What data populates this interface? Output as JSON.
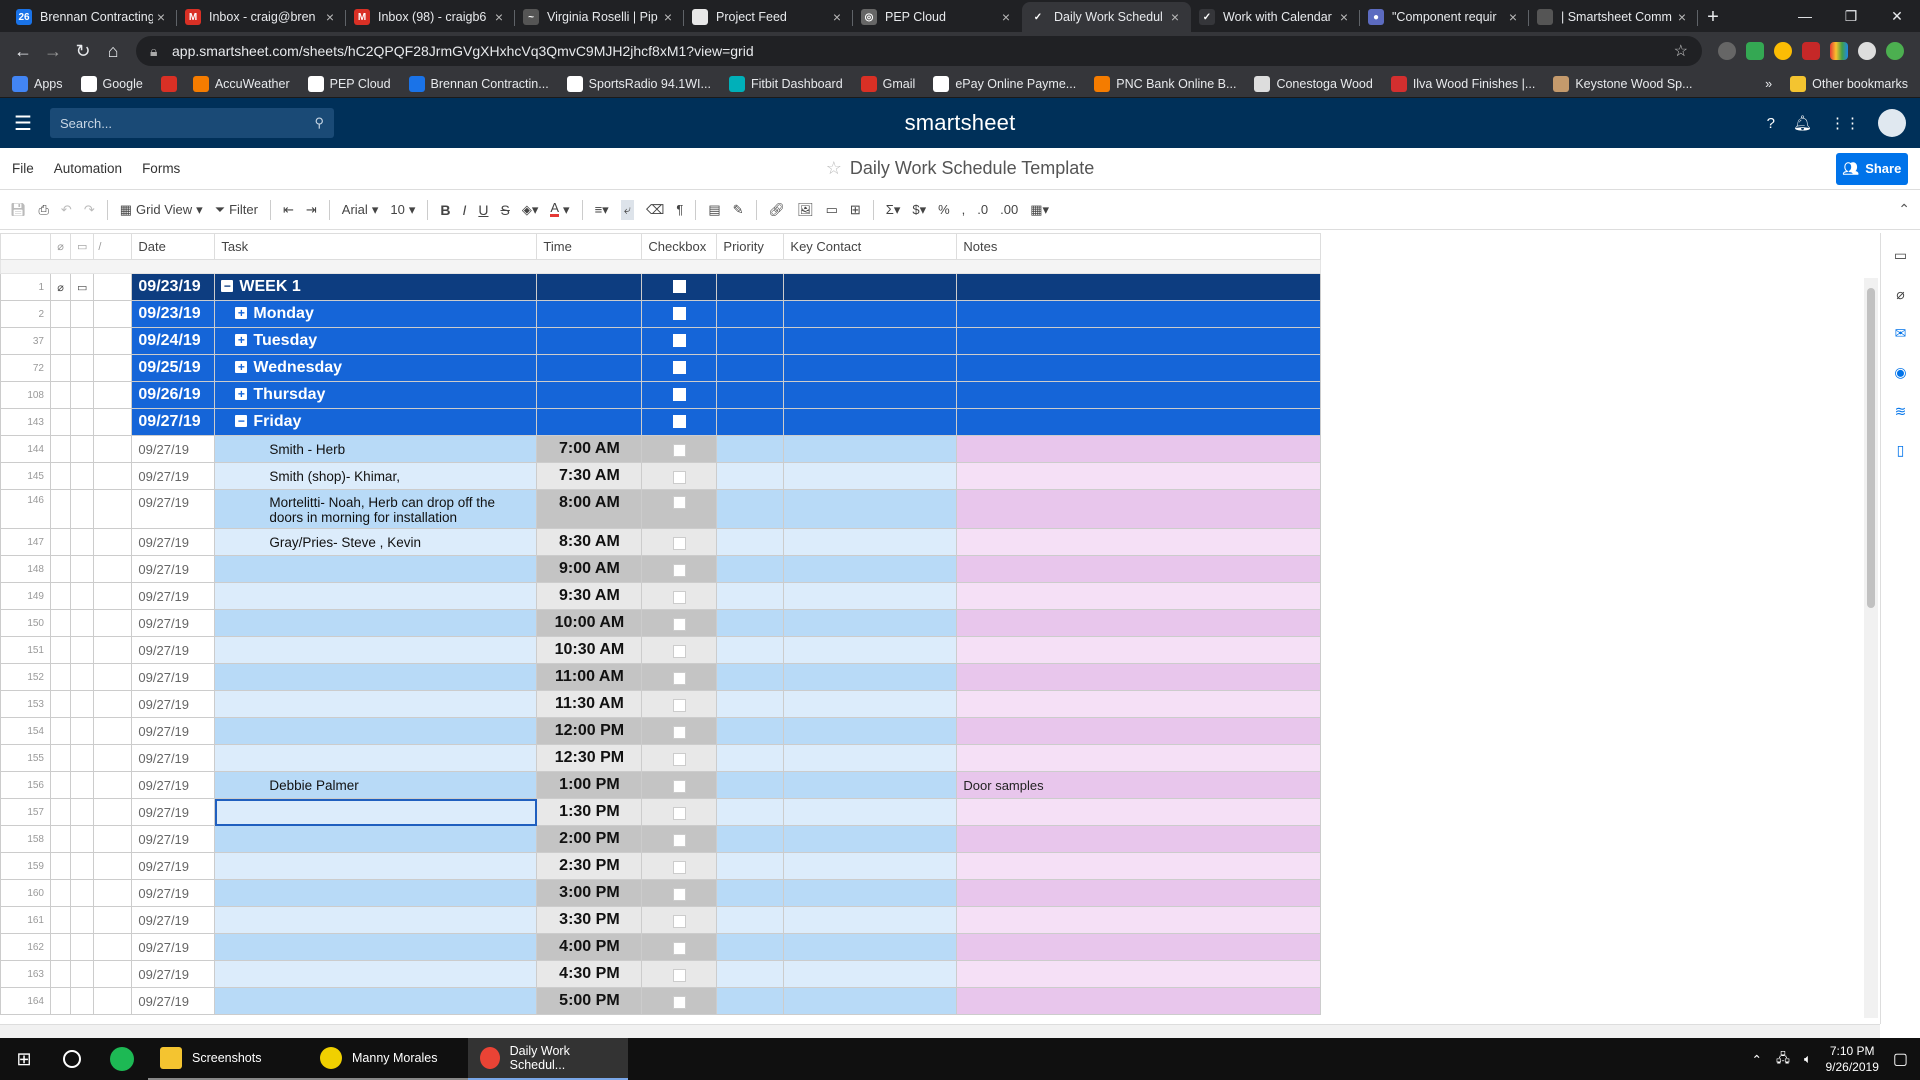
{
  "browser": {
    "tabs": [
      {
        "title": "Brennan Contracting",
        "color": "#1a73e8",
        "glyph": "26"
      },
      {
        "title": "Inbox - craig@bren",
        "color": "#d93025",
        "glyph": "M"
      },
      {
        "title": "Inbox (98) - craigb6",
        "color": "#d93025",
        "glyph": "M"
      },
      {
        "title": "Virginia Roselli | Pip",
        "color": "#555",
        "glyph": "~"
      },
      {
        "title": "Project Feed",
        "color": "#e8e8e8",
        "glyph": ""
      },
      {
        "title": "PEP Cloud",
        "color": "#666",
        "glyph": "◎"
      },
      {
        "title": "Daily Work Schedul",
        "color": "#35363a",
        "glyph": "✓"
      },
      {
        "title": "Work with Calendar",
        "color": "#35363a",
        "glyph": "✓"
      },
      {
        "title": "\"Component requir",
        "color": "#5c6bc0",
        "glyph": "●"
      },
      {
        "title": "| Smartsheet Comm",
        "color": "#555",
        "glyph": ""
      }
    ],
    "active_tab": 6,
    "url": "app.smartsheet.com/sheets/hC2QPQF28JrmGVgXHxhcVq3QmvC9MJH2jhcf8xM1?view=grid",
    "bookmarks": [
      "Apps",
      "Google",
      "",
      "AccuWeather",
      "PEP Cloud",
      "Brennan Contractin...",
      "SportsRadio 94.1WI...",
      "Fitbit Dashboard",
      "Gmail",
      "ePay Online Payme...",
      "PNC Bank Online B...",
      "Conestoga Wood",
      "Ilva Wood Finishes |...",
      "Keystone Wood Sp..."
    ],
    "bookmark_colors": [
      "#4285f4",
      "#fff",
      "#d93025",
      "#f57c00",
      "#fff",
      "#1a73e8",
      "#fff",
      "#00b0b9",
      "#d93025",
      "#fff",
      "#f57c00",
      "#ddd",
      "#d32f2f",
      "#c49a6c"
    ],
    "other_bookmarks": "Other bookmarks",
    "overflow": "»"
  },
  "app": {
    "search_placeholder": "Search...",
    "logo": "smartsheet",
    "menu": [
      "File",
      "Automation",
      "Forms"
    ],
    "sheet_title": "Daily Work Schedule Template",
    "share_label": "Share"
  },
  "toolbar": {
    "grid_view": "Grid View",
    "filter": "Filter",
    "font": "Arial",
    "font_size": "10"
  },
  "grid": {
    "columns": [
      "Date",
      "Task",
      "Time",
      "Checkbox",
      "Priority",
      "Key Contact",
      "Notes"
    ],
    "parent_rows": [
      {
        "num": "1",
        "date": "09/23/19",
        "task": "WEEK 1",
        "toggle": "−",
        "kind": "week"
      },
      {
        "num": "2",
        "date": "09/23/19",
        "task": "Monday",
        "toggle": "+",
        "kind": "day"
      },
      {
        "num": "37",
        "date": "09/24/19",
        "task": "Tuesday",
        "toggle": "+",
        "kind": "day"
      },
      {
        "num": "72",
        "date": "09/25/19",
        "task": "Wednesday",
        "toggle": "+",
        "kind": "day"
      },
      {
        "num": "108",
        "date": "09/26/19",
        "task": "Thursday",
        "toggle": "+",
        "kind": "day"
      },
      {
        "num": "143",
        "date": "09/27/19",
        "task": "Friday",
        "toggle": "−",
        "kind": "day"
      }
    ],
    "child_rows": [
      {
        "num": "144",
        "date": "09/27/19",
        "task": "Smith - Herb",
        "time": "7:00 AM",
        "notes": ""
      },
      {
        "num": "145",
        "date": "09/27/19",
        "task": "Smith (shop)- Khimar,",
        "time": "7:30 AM",
        "notes": ""
      },
      {
        "num": "146",
        "date": "09/27/19",
        "task": "Mortelitti- Noah, Herb can drop off the doors in morning for installation",
        "time": "8:00 AM",
        "notes": "",
        "tall": true
      },
      {
        "num": "147",
        "date": "09/27/19",
        "task": "Gray/Pries- Steve , Kevin",
        "time": "8:30 AM",
        "notes": ""
      },
      {
        "num": "148",
        "date": "09/27/19",
        "task": "",
        "time": "9:00 AM",
        "notes": ""
      },
      {
        "num": "149",
        "date": "09/27/19",
        "task": "",
        "time": "9:30 AM",
        "notes": ""
      },
      {
        "num": "150",
        "date": "09/27/19",
        "task": "",
        "time": "10:00 AM",
        "notes": ""
      },
      {
        "num": "151",
        "date": "09/27/19",
        "task": "",
        "time": "10:30 AM",
        "notes": ""
      },
      {
        "num": "152",
        "date": "09/27/19",
        "task": "",
        "time": "11:00 AM",
        "notes": ""
      },
      {
        "num": "153",
        "date": "09/27/19",
        "task": "",
        "time": "11:30 AM",
        "notes": ""
      },
      {
        "num": "154",
        "date": "09/27/19",
        "task": "",
        "time": "12:00 PM",
        "notes": ""
      },
      {
        "num": "155",
        "date": "09/27/19",
        "task": "",
        "time": "12:30 PM",
        "notes": ""
      },
      {
        "num": "156",
        "date": "09/27/19",
        "task": "Debbie Palmer",
        "time": "1:00 PM",
        "notes": "Door samples"
      },
      {
        "num": "157",
        "date": "09/27/19",
        "task": "",
        "time": "1:30 PM",
        "notes": "",
        "selected": true
      },
      {
        "num": "158",
        "date": "09/27/19",
        "task": "",
        "time": "2:00 PM",
        "notes": ""
      },
      {
        "num": "159",
        "date": "09/27/19",
        "task": "",
        "time": "2:30 PM",
        "notes": ""
      },
      {
        "num": "160",
        "date": "09/27/19",
        "task": "",
        "time": "3:00 PM",
        "notes": ""
      },
      {
        "num": "161",
        "date": "09/27/19",
        "task": "",
        "time": "3:30 PM",
        "notes": ""
      },
      {
        "num": "162",
        "date": "09/27/19",
        "task": "",
        "time": "4:00 PM",
        "notes": ""
      },
      {
        "num": "163",
        "date": "09/27/19",
        "task": "",
        "time": "4:30 PM",
        "notes": ""
      },
      {
        "num": "164",
        "date": "09/27/19",
        "task": "",
        "time": "5:00 PM",
        "notes": ""
      }
    ]
  },
  "taskbar": {
    "apps": [
      {
        "label": "Screenshots",
        "color": "#f4c430"
      },
      {
        "label": "Manny Morales",
        "color": "#f0d000"
      },
      {
        "label": "Daily Work Schedul...",
        "color": "#ea4335"
      }
    ],
    "time": "7:10 PM",
    "date": "9/26/2019"
  },
  "colors": {
    "header_bg": "#003059",
    "week_row": "#0d3d80",
    "day_row": "#1565d8",
    "share_button": "#0073ea"
  }
}
